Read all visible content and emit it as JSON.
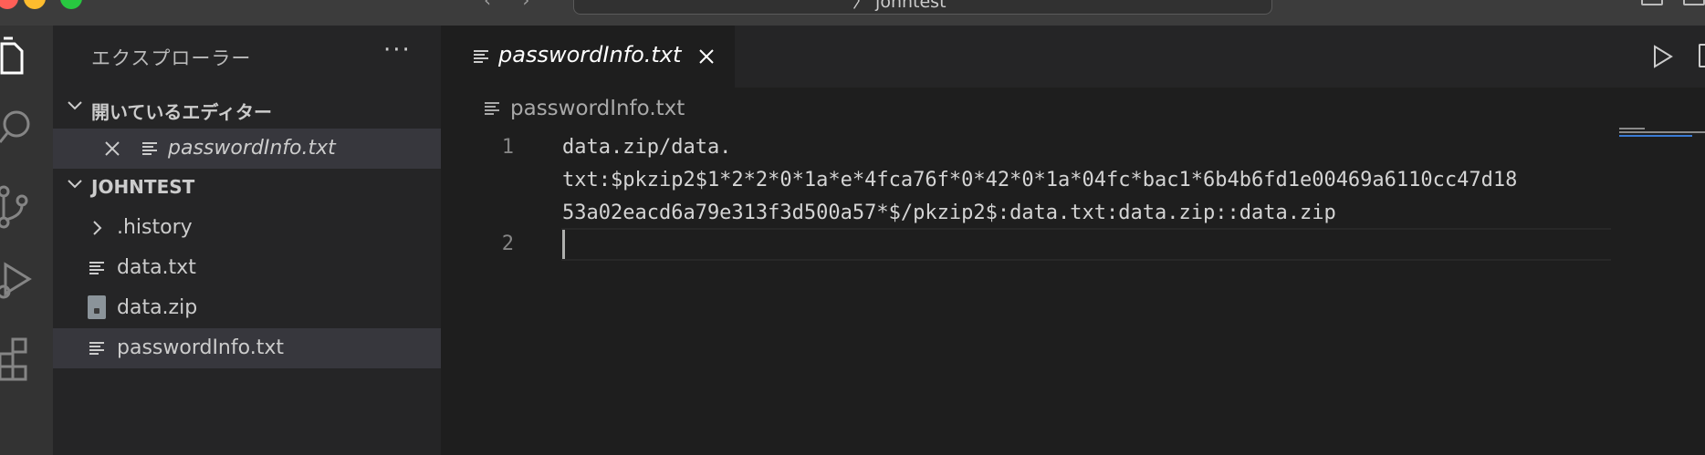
{
  "titlebar": {
    "nav_arrows": "‹ ›",
    "command_text": "〉 johntest"
  },
  "sidebar": {
    "title": "エクスプローラー",
    "more": "···",
    "open_editors": {
      "header": "開いているエディター",
      "items": [
        {
          "label": "passwordInfo.txt"
        }
      ]
    },
    "workspace": {
      "header": "JOHNTEST",
      "items": [
        {
          "label": ".history",
          "kind": "folder"
        },
        {
          "label": "data.txt",
          "kind": "text-file"
        },
        {
          "label": "data.zip",
          "kind": "zip-file"
        },
        {
          "label": "passwordInfo.txt",
          "kind": "text-file",
          "selected": true
        }
      ]
    }
  },
  "editor": {
    "tab_label": "passwordInfo.txt",
    "breadcrumb": "passwordInfo.txt",
    "line_numbers": [
      "1",
      "2"
    ],
    "line1_wrapped": [
      "data.zip/data.",
      "txt:$pkzip2$1*2*2*0*1a*e*4fca76f*0*42*0*1a*04fc*bac1*6b4b6fd1e00469a6110cc47d18",
      "53a02eacd6a79e313f3d500a57*$/pkzip2$:data.txt:data.zip::data.zip"
    ],
    "line2": ""
  },
  "icons": {
    "explorer": "files-icon",
    "search": "search-icon",
    "scm": "source-control-icon",
    "debug": "run-debug-icon",
    "extensions": "extensions-icon",
    "run": "run-icon",
    "split": "split-editor-icon"
  },
  "colors": {
    "background": "#1e1e1e",
    "sidebar": "#252526",
    "activitybar": "#333333",
    "selection": "#37373d"
  }
}
